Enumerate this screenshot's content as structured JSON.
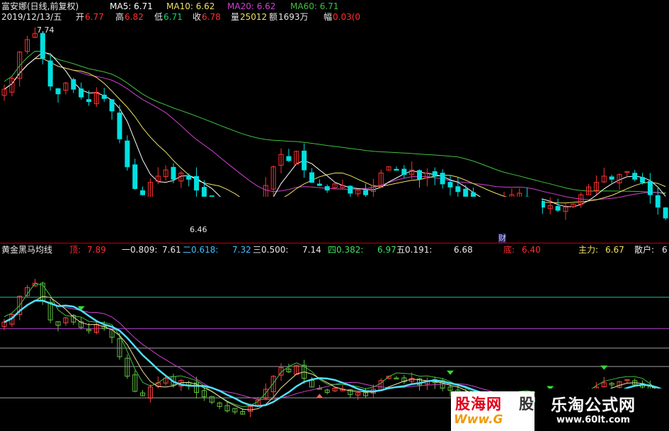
{
  "header": {
    "stock_title": "富安娜(日线,前复权)",
    "ma5": "MA5: 6.71",
    "ma10": "MA10: 6.62",
    "ma20": "MA20: 6.62",
    "ma60": "MA60: 6.71",
    "date": "2019/12/13/五",
    "open_label": "开",
    "open_value": "6.77",
    "high_label": "高",
    "high_value": "6.82",
    "low_label": "低",
    "low_value": "6.71",
    "close_label": "收",
    "close_value": "6.78",
    "vol_label": "量",
    "vol_value": "25012",
    "amount_label": "额",
    "amount_value": "1693万",
    "amp_label": "幅",
    "amp_value": "0.03(0"
  },
  "price_chart": {
    "high_marker": "7.74",
    "low_marker": "6.46",
    "event_marker": "财"
  },
  "indicator": {
    "name": "黄金黑马均线",
    "top_label": "顶:",
    "top_value": "7.89",
    "l1_label": "一0.809:",
    "l1_value": "7.61",
    "l2_label": "二0.618:",
    "l2_value": "7.32",
    "l3_label": "三0.500:",
    "l3_value": "7.14",
    "l4_label": "四0.382:",
    "l4_value": "6.97",
    "l5_label": "五0.191:",
    "l5_value": "6.68",
    "bottom_label": "底:",
    "bottom_value": "6.40",
    "main_label": "主力:",
    "main_value": "6.67",
    "retail_label": "散户:",
    "retail_value": "6"
  },
  "watermarks": {
    "gu_hai_wang": "股海网",
    "gu_hai_cut": "股",
    "gu_hai_url": "Www.G",
    "le_tao": "乐淘公式网",
    "le_tao_url": "www.60lt.com"
  },
  "colors": {
    "up": "#ff3030",
    "down": "#00e0e0",
    "ma5": "#ffffff",
    "ma10": "#f0e060",
    "ma20": "#d040d0",
    "ma60": "#40c040",
    "teal_line": "#4fe0ff",
    "fib_line": "#20c0a0",
    "purple_level": "#b040d0",
    "gray_level": "#a0a0a0",
    "divider": "#c00000"
  },
  "chart_data": {
    "type": "candlestick",
    "closes": [
      7.38,
      7.45,
      7.62,
      7.7,
      7.74,
      7.58,
      7.4,
      7.35,
      7.42,
      7.38,
      7.33,
      7.3,
      7.36,
      7.32,
      7.24,
      7.06,
      6.88,
      6.74,
      6.7,
      6.78,
      6.82,
      6.86,
      6.8,
      6.84,
      6.8,
      6.73,
      6.69,
      6.64,
      6.6,
      6.56,
      6.55,
      6.53,
      6.6,
      6.66,
      6.76,
      6.88,
      6.96,
      6.92,
      6.98,
      6.86,
      6.78,
      6.76,
      6.73,
      6.77,
      6.76,
      6.71,
      6.73,
      6.7,
      6.76,
      6.84,
      6.88,
      6.86,
      6.83,
      6.86,
      6.8,
      6.84,
      6.82,
      6.77,
      6.75,
      6.72,
      6.69,
      6.64,
      6.62,
      6.63,
      6.6,
      6.66,
      6.7,
      6.71,
      6.68,
      6.65,
      6.62,
      6.63,
      6.6,
      6.62,
      6.64,
      6.7,
      6.75,
      6.78,
      6.82,
      6.8,
      6.83,
      6.85,
      6.8,
      6.78,
      6.7,
      6.62,
      6.55
    ]
  }
}
